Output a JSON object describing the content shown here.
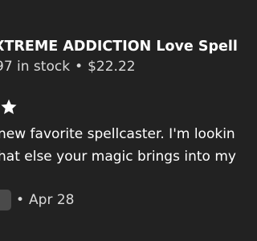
{
  "listing": {
    "title": "XTREME ADDICTION Love Spell + Re",
    "stock": "97 in stock",
    "separator": "•",
    "price": "$22.22"
  },
  "review": {
    "rating": 5,
    "star_icon": "star-icon",
    "text_lines": [
      "new favorite spellcaster. I'm lookin",
      "hat else your magic brings into my"
    ],
    "date": "Apr 28",
    "separator": "•",
    "avatar_icon": "avatar"
  },
  "colors": {
    "background": "#222222",
    "text": "#ffffff",
    "muted_text": "#d9d9d9"
  }
}
